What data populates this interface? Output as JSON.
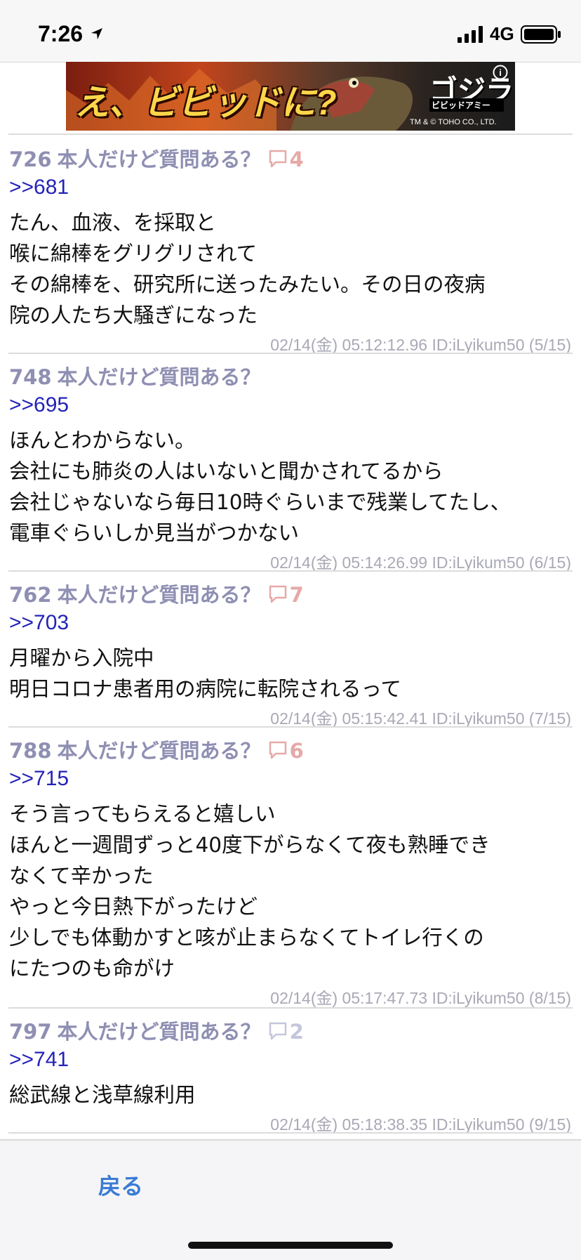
{
  "status_bar": {
    "time": "7:26",
    "network": "4G",
    "icons": [
      "location-arrow-icon",
      "signal-icon",
      "battery-icon"
    ]
  },
  "ad": {
    "title": "え、ビビッドに?",
    "brand": "ゴジラ",
    "sub": "ビビッドアミー",
    "copyright": "TM & © TOHO CO., LTD.",
    "info": "i"
  },
  "posts": [
    {
      "number": "726",
      "title": "本人だけど質問ある？",
      "reply_count": "4",
      "badge_color": "pink",
      "anchor": ">>681",
      "lines": [
        "たん、血液、を採取と",
        "喉に綿棒をグリグリされて",
        "その綿棒を、研究所に送ったみたい。その日の夜病",
        "院の人たち大騒ぎになった"
      ],
      "meta": "02/14(金) 05:12:12.96 ID:iLyikum50 (5/15)"
    },
    {
      "number": "748",
      "title": "本人だけど質問ある？",
      "reply_count": "",
      "badge_color": "none",
      "anchor": ">>695",
      "lines": [
        "ほんとわからない。",
        "会社にも肺炎の人はいないと聞かされてるから",
        "会社じゃないなら毎日10時ぐらいまで残業してたし、",
        "電車ぐらいしか見当がつかない"
      ],
      "meta": "02/14(金) 05:14:26.99 ID:iLyikum50 (6/15)"
    },
    {
      "number": "762",
      "title": "本人だけど質問ある？",
      "reply_count": "7",
      "badge_color": "pink",
      "anchor": ">>703",
      "lines": [
        "月曜から入院中",
        "明日コロナ患者用の病院に転院されるって"
      ],
      "meta": "02/14(金) 05:15:42.41 ID:iLyikum50 (7/15)"
    },
    {
      "number": "788",
      "title": "本人だけど質問ある？",
      "reply_count": "6",
      "badge_color": "pink",
      "anchor": ">>715",
      "lines": [
        "そう言ってもらえると嬉しい",
        "ほんと一週間ずっと40度下がらなくて夜も熟睡でき",
        "なくて辛かった",
        "やっと今日熱下がったけど",
        "少しでも体動かすと咳が止まらなくてトイレ行くの",
        "にたつのも命がけ"
      ],
      "meta": "02/14(金) 05:17:47.73 ID:iLyikum50 (8/15)"
    },
    {
      "number": "797",
      "title": "本人だけど質問ある？",
      "reply_count": "2",
      "badge_color": "lavender",
      "anchor": ">>741",
      "lines": [
        "総武線と浅草線利用"
      ],
      "meta": "02/14(金) 05:18:38.35 ID:iLyikum50 (9/15)"
    }
  ],
  "toolbar": {
    "back_label": "戻る"
  },
  "colors": {
    "header": "#8f8fb3",
    "anchor": "#2323b8",
    "badge_pink": "#e6a9a8",
    "badge_lavender": "#c4c6dc",
    "meta": "#a9a9b6",
    "back": "#3a7bd5"
  }
}
